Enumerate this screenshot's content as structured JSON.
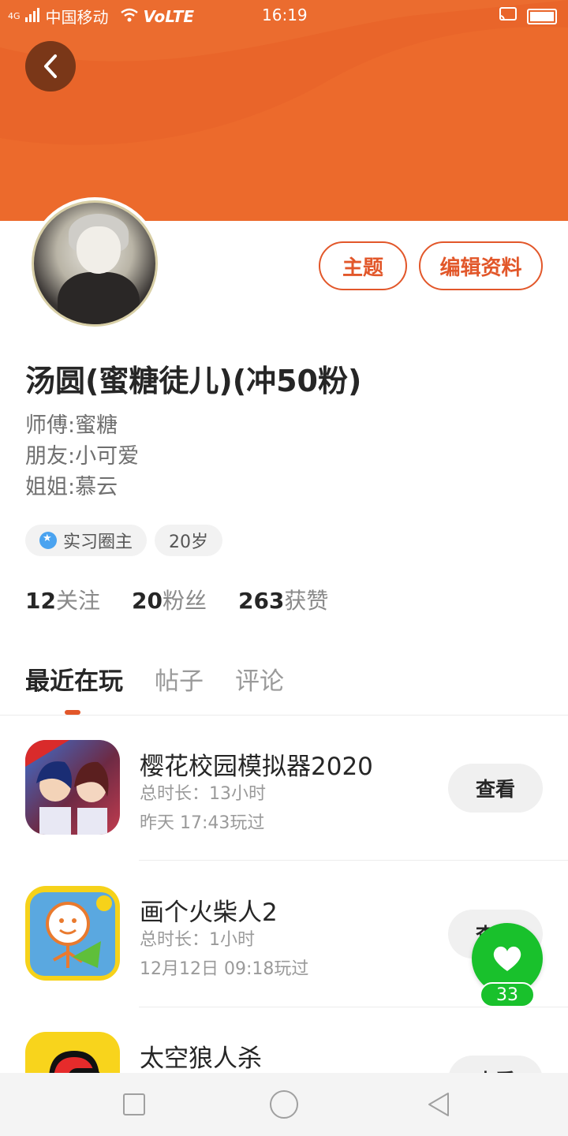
{
  "status_bar": {
    "network": "4G",
    "carrier": "中国移动",
    "volte": "VoLTE",
    "time": "16:19"
  },
  "header": {
    "back_icon": "chevron-left-icon",
    "banner_color": "#ec6a2c"
  },
  "profile": {
    "theme_button": "主题",
    "edit_button": "编辑资料",
    "username": "汤圆(蜜糖徒儿)(冲50粉)",
    "bio_lines": [
      "师傅:蜜糖",
      "朋友:小可爱",
      "姐姐:慕云"
    ],
    "tags": [
      {
        "label": "实习圈主",
        "icon": "badge-icon"
      },
      {
        "label": "20岁"
      }
    ],
    "stats": [
      {
        "num": "12",
        "label": "关注"
      },
      {
        "num": "20",
        "label": "粉丝"
      },
      {
        "num": "263",
        "label": "获赞"
      }
    ]
  },
  "tabs": [
    "最近在玩",
    "帖子",
    "评论"
  ],
  "games": [
    {
      "title": "樱花校园模拟器2020",
      "duration": "总时长：13小时",
      "last_played": "昨天 17:43玩过",
      "button": "查看"
    },
    {
      "title": "画个火柴人2",
      "duration": "总时长：1小时",
      "last_played": "12月12日 09:18玩过",
      "button": "查看"
    },
    {
      "title": "太空狼人杀",
      "duration": "",
      "last_played": "",
      "button": "查看"
    }
  ],
  "like": {
    "count": "33",
    "icon": "heart-icon",
    "color": "#19c12c"
  },
  "accent_color": "#e2572a"
}
